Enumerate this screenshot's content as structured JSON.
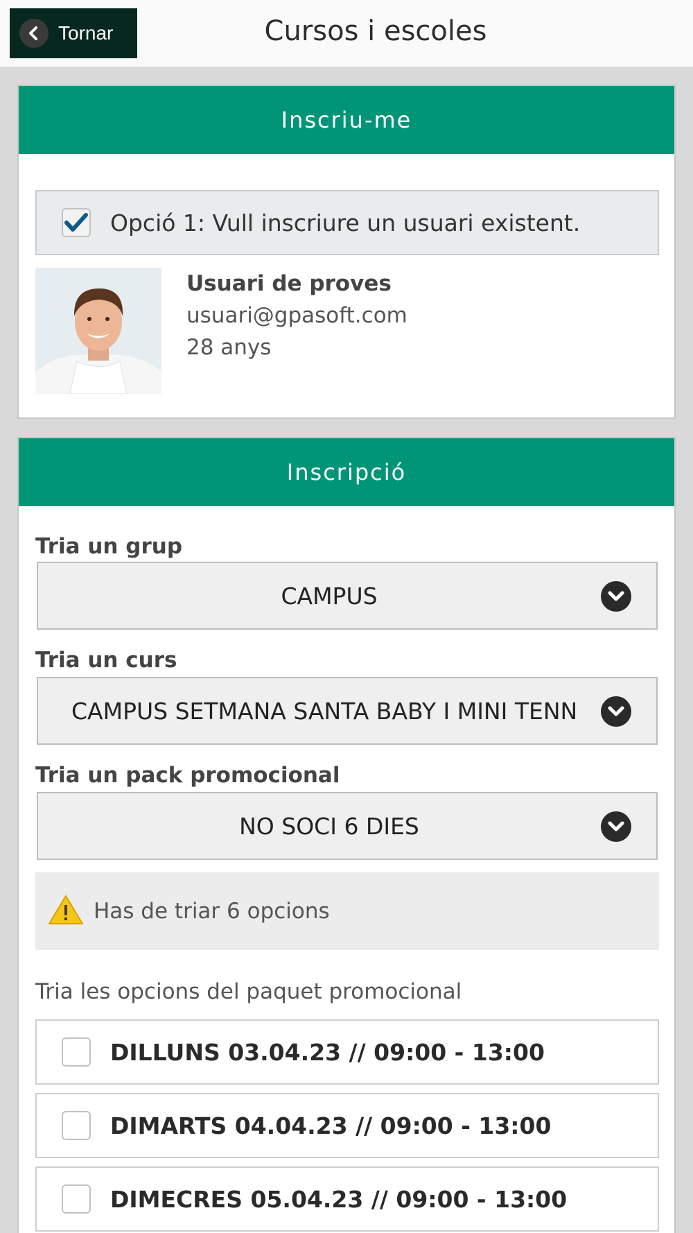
{
  "header": {
    "back_label": "Tornar",
    "title": "Cursos i escoles"
  },
  "enroll_card": {
    "title": "Inscriu-me",
    "option_label": "Opció 1: Vull inscriure un usuari existent.",
    "option_checked": true,
    "user": {
      "name": "Usuari de proves",
      "email": "usuari@gpasoft.com",
      "age": "28 anys"
    }
  },
  "registration_card": {
    "title": "Inscripció",
    "group": {
      "label": "Tria un grup",
      "value": "CAMPUS"
    },
    "course": {
      "label": "Tria un curs",
      "value": "CAMPUS SETMANA SANTA BABY I MINI TENN"
    },
    "pack": {
      "label": "Tria un pack promocional",
      "value": "NO SOCI 6 DIES"
    },
    "warning": "Has de triar 6 opcions",
    "pack_options_title": "Tria les opcions del paquet promocional",
    "days": [
      {
        "label": "DILLUNS 03.04.23 // 09:00 - 13:00",
        "checked": false
      },
      {
        "label": "DIMARTS 04.04.23 // 09:00 - 13:00",
        "checked": false
      },
      {
        "label": "DIMECRES 05.04.23 // 09:00 - 13:00",
        "checked": false
      }
    ]
  },
  "colors": {
    "header_green": "#019577",
    "back_button": "#07281f",
    "warning_yellow": "#f5c518"
  }
}
